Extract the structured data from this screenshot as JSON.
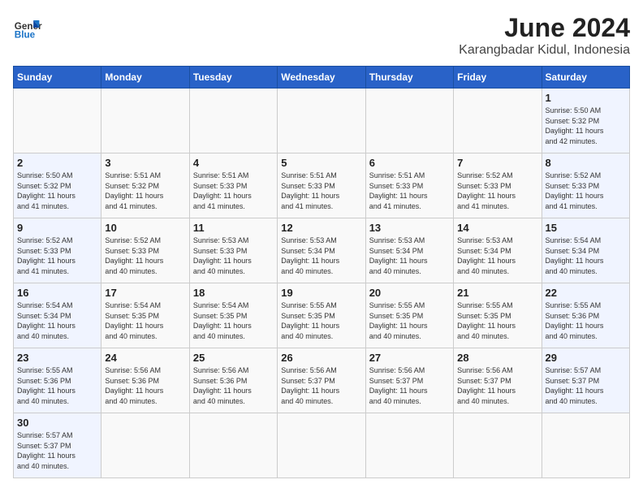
{
  "header": {
    "logo_line1": "General",
    "logo_line2": "Blue",
    "main_title": "June 2024",
    "subtitle": "Karangbadar Kidul, Indonesia"
  },
  "days_of_week": [
    "Sunday",
    "Monday",
    "Tuesday",
    "Wednesday",
    "Thursday",
    "Friday",
    "Saturday"
  ],
  "weeks": [
    [
      {
        "day": "",
        "info": ""
      },
      {
        "day": "",
        "info": ""
      },
      {
        "day": "",
        "info": ""
      },
      {
        "day": "",
        "info": ""
      },
      {
        "day": "",
        "info": ""
      },
      {
        "day": "",
        "info": ""
      },
      {
        "day": "1",
        "info": "Sunrise: 5:50 AM\nSunset: 5:32 PM\nDaylight: 11 hours\nand 42 minutes."
      }
    ],
    [
      {
        "day": "2",
        "info": "Sunrise: 5:50 AM\nSunset: 5:32 PM\nDaylight: 11 hours\nand 41 minutes."
      },
      {
        "day": "3",
        "info": "Sunrise: 5:51 AM\nSunset: 5:32 PM\nDaylight: 11 hours\nand 41 minutes."
      },
      {
        "day": "4",
        "info": "Sunrise: 5:51 AM\nSunset: 5:33 PM\nDaylight: 11 hours\nand 41 minutes."
      },
      {
        "day": "5",
        "info": "Sunrise: 5:51 AM\nSunset: 5:33 PM\nDaylight: 11 hours\nand 41 minutes."
      },
      {
        "day": "6",
        "info": "Sunrise: 5:51 AM\nSunset: 5:33 PM\nDaylight: 11 hours\nand 41 minutes."
      },
      {
        "day": "7",
        "info": "Sunrise: 5:52 AM\nSunset: 5:33 PM\nDaylight: 11 hours\nand 41 minutes."
      },
      {
        "day": "8",
        "info": "Sunrise: 5:52 AM\nSunset: 5:33 PM\nDaylight: 11 hours\nand 41 minutes."
      }
    ],
    [
      {
        "day": "9",
        "info": "Sunrise: 5:52 AM\nSunset: 5:33 PM\nDaylight: 11 hours\nand 41 minutes."
      },
      {
        "day": "10",
        "info": "Sunrise: 5:52 AM\nSunset: 5:33 PM\nDaylight: 11 hours\nand 40 minutes."
      },
      {
        "day": "11",
        "info": "Sunrise: 5:53 AM\nSunset: 5:33 PM\nDaylight: 11 hours\nand 40 minutes."
      },
      {
        "day": "12",
        "info": "Sunrise: 5:53 AM\nSunset: 5:34 PM\nDaylight: 11 hours\nand 40 minutes."
      },
      {
        "day": "13",
        "info": "Sunrise: 5:53 AM\nSunset: 5:34 PM\nDaylight: 11 hours\nand 40 minutes."
      },
      {
        "day": "14",
        "info": "Sunrise: 5:53 AM\nSunset: 5:34 PM\nDaylight: 11 hours\nand 40 minutes."
      },
      {
        "day": "15",
        "info": "Sunrise: 5:54 AM\nSunset: 5:34 PM\nDaylight: 11 hours\nand 40 minutes."
      }
    ],
    [
      {
        "day": "16",
        "info": "Sunrise: 5:54 AM\nSunset: 5:34 PM\nDaylight: 11 hours\nand 40 minutes."
      },
      {
        "day": "17",
        "info": "Sunrise: 5:54 AM\nSunset: 5:35 PM\nDaylight: 11 hours\nand 40 minutes."
      },
      {
        "day": "18",
        "info": "Sunrise: 5:54 AM\nSunset: 5:35 PM\nDaylight: 11 hours\nand 40 minutes."
      },
      {
        "day": "19",
        "info": "Sunrise: 5:55 AM\nSunset: 5:35 PM\nDaylight: 11 hours\nand 40 minutes."
      },
      {
        "day": "20",
        "info": "Sunrise: 5:55 AM\nSunset: 5:35 PM\nDaylight: 11 hours\nand 40 minutes."
      },
      {
        "day": "21",
        "info": "Sunrise: 5:55 AM\nSunset: 5:35 PM\nDaylight: 11 hours\nand 40 minutes."
      },
      {
        "day": "22",
        "info": "Sunrise: 5:55 AM\nSunset: 5:36 PM\nDaylight: 11 hours\nand 40 minutes."
      }
    ],
    [
      {
        "day": "23",
        "info": "Sunrise: 5:55 AM\nSunset: 5:36 PM\nDaylight: 11 hours\nand 40 minutes."
      },
      {
        "day": "24",
        "info": "Sunrise: 5:56 AM\nSunset: 5:36 PM\nDaylight: 11 hours\nand 40 minutes."
      },
      {
        "day": "25",
        "info": "Sunrise: 5:56 AM\nSunset: 5:36 PM\nDaylight: 11 hours\nand 40 minutes."
      },
      {
        "day": "26",
        "info": "Sunrise: 5:56 AM\nSunset: 5:37 PM\nDaylight: 11 hours\nand 40 minutes."
      },
      {
        "day": "27",
        "info": "Sunrise: 5:56 AM\nSunset: 5:37 PM\nDaylight: 11 hours\nand 40 minutes."
      },
      {
        "day": "28",
        "info": "Sunrise: 5:56 AM\nSunset: 5:37 PM\nDaylight: 11 hours\nand 40 minutes."
      },
      {
        "day": "29",
        "info": "Sunrise: 5:57 AM\nSunset: 5:37 PM\nDaylight: 11 hours\nand 40 minutes."
      }
    ],
    [
      {
        "day": "30",
        "info": "Sunrise: 5:57 AM\nSunset: 5:37 PM\nDaylight: 11 hours\nand 40 minutes."
      },
      {
        "day": "",
        "info": ""
      },
      {
        "day": "",
        "info": ""
      },
      {
        "day": "",
        "info": ""
      },
      {
        "day": "",
        "info": ""
      },
      {
        "day": "",
        "info": ""
      },
      {
        "day": "",
        "info": ""
      }
    ]
  ]
}
